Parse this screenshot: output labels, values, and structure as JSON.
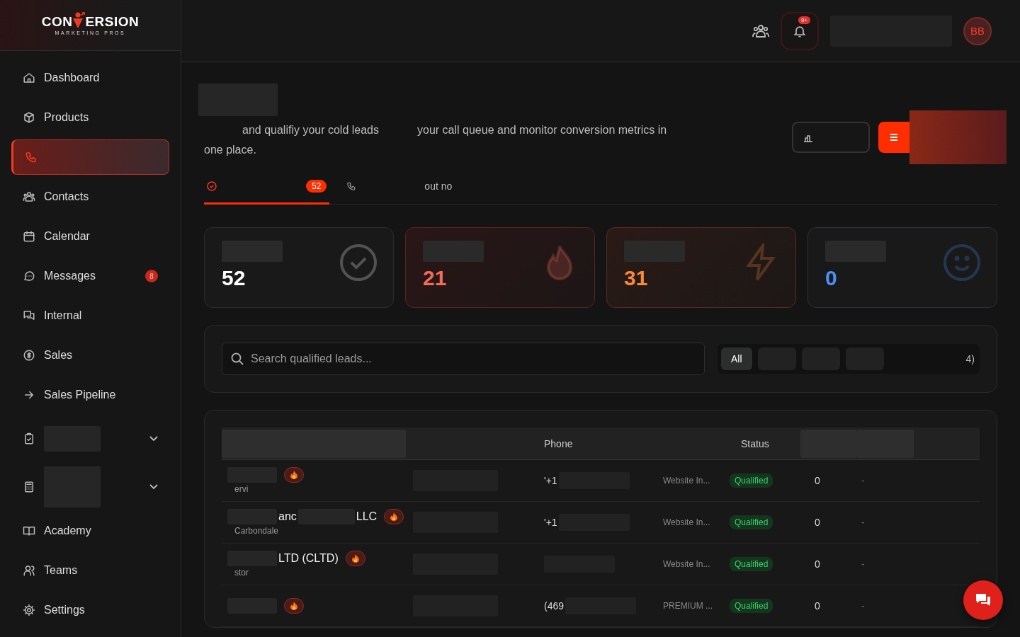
{
  "brand": {
    "name_start": "CON",
    "name_end": "ERSION",
    "tagline": "MARKETING PROS"
  },
  "sidebar": {
    "items": [
      {
        "label": "Dashboard",
        "selected": false
      },
      {
        "label": "Products",
        "selected": false
      },
      {
        "selected": true
      },
      {
        "label": "Contacts",
        "selected": false
      },
      {
        "label": "Calendar",
        "selected": false
      },
      {
        "label": "Messages",
        "selected": false,
        "badge": "8"
      },
      {
        "label": "Internal",
        "selected": false
      },
      {
        "label": "Sales",
        "selected": false
      },
      {
        "label": "Sales Pipeline",
        "selected": false
      },
      {
        "selected": false,
        "expandable": true
      },
      {
        "selected": false,
        "expandable": true
      },
      {
        "label": "Academy",
        "selected": false
      },
      {
        "label": "Teams",
        "selected": false
      },
      {
        "label": "Settings",
        "selected": false
      }
    ]
  },
  "header": {
    "notification_badge": "9+",
    "avatar_initials": "BB"
  },
  "intro": {
    "segments": [
      {
        "kind": "redacted"
      },
      {
        "kind": "text",
        "text": "and qualifiy your cold leads"
      },
      {
        "kind": "redacted"
      },
      {
        "kind": "text",
        "text": "your call queue and monitor conversion metrics in one place."
      }
    ]
  },
  "tabs": [
    {
      "kind": "check",
      "badge": "52",
      "selected": true
    },
    {
      "kind": "phone",
      "text": "out no",
      "selected": false
    }
  ],
  "stats": [
    {
      "value": "52",
      "kind": "total",
      "color": "#ffffff"
    },
    {
      "value": "21",
      "kind": "hot",
      "color": "#f26b5b"
    },
    {
      "value": "31",
      "kind": "warm",
      "color": "#f7893a"
    },
    {
      "value": "0",
      "kind": "cold",
      "color": "#4d8ef7"
    }
  ],
  "search": {
    "placeholder": "Search qualified leads..."
  },
  "filters": [
    {
      "label": "All",
      "selected": true
    },
    {
      "selected": false
    },
    {
      "selected": false
    },
    {
      "selected": false
    },
    {
      "label": "4)",
      "selected": false
    }
  ],
  "table": {
    "columns": [
      {
        "kind": "redacted"
      },
      {
        "kind": "blank"
      },
      {
        "kind": "text",
        "label": "Phone"
      },
      {
        "kind": "blank"
      },
      {
        "kind": "text",
        "label": "Status"
      },
      {
        "kind": "redacted"
      },
      {
        "kind": "redacted"
      }
    ],
    "rows": [
      {
        "location": "ervi",
        "phone": "'+1",
        "source": "Website In...",
        "status": "Qualified",
        "count": "0",
        "last": "-"
      },
      {
        "name": "anc",
        "name_end": "LLC",
        "location": "Carbondale",
        "phone": "'+1",
        "source": "Website In...",
        "status": "Qualified",
        "count": "0",
        "last": "-"
      },
      {
        "name_end": "LTD (CLTD)",
        "location": "stor",
        "source": "Website In...",
        "status": "Qualified",
        "count": "0",
        "last": "-"
      },
      {
        "phone": "(469",
        "source": "PREMIUM ...",
        "status": "Qualified",
        "count": "0",
        "last": "-"
      }
    ]
  }
}
